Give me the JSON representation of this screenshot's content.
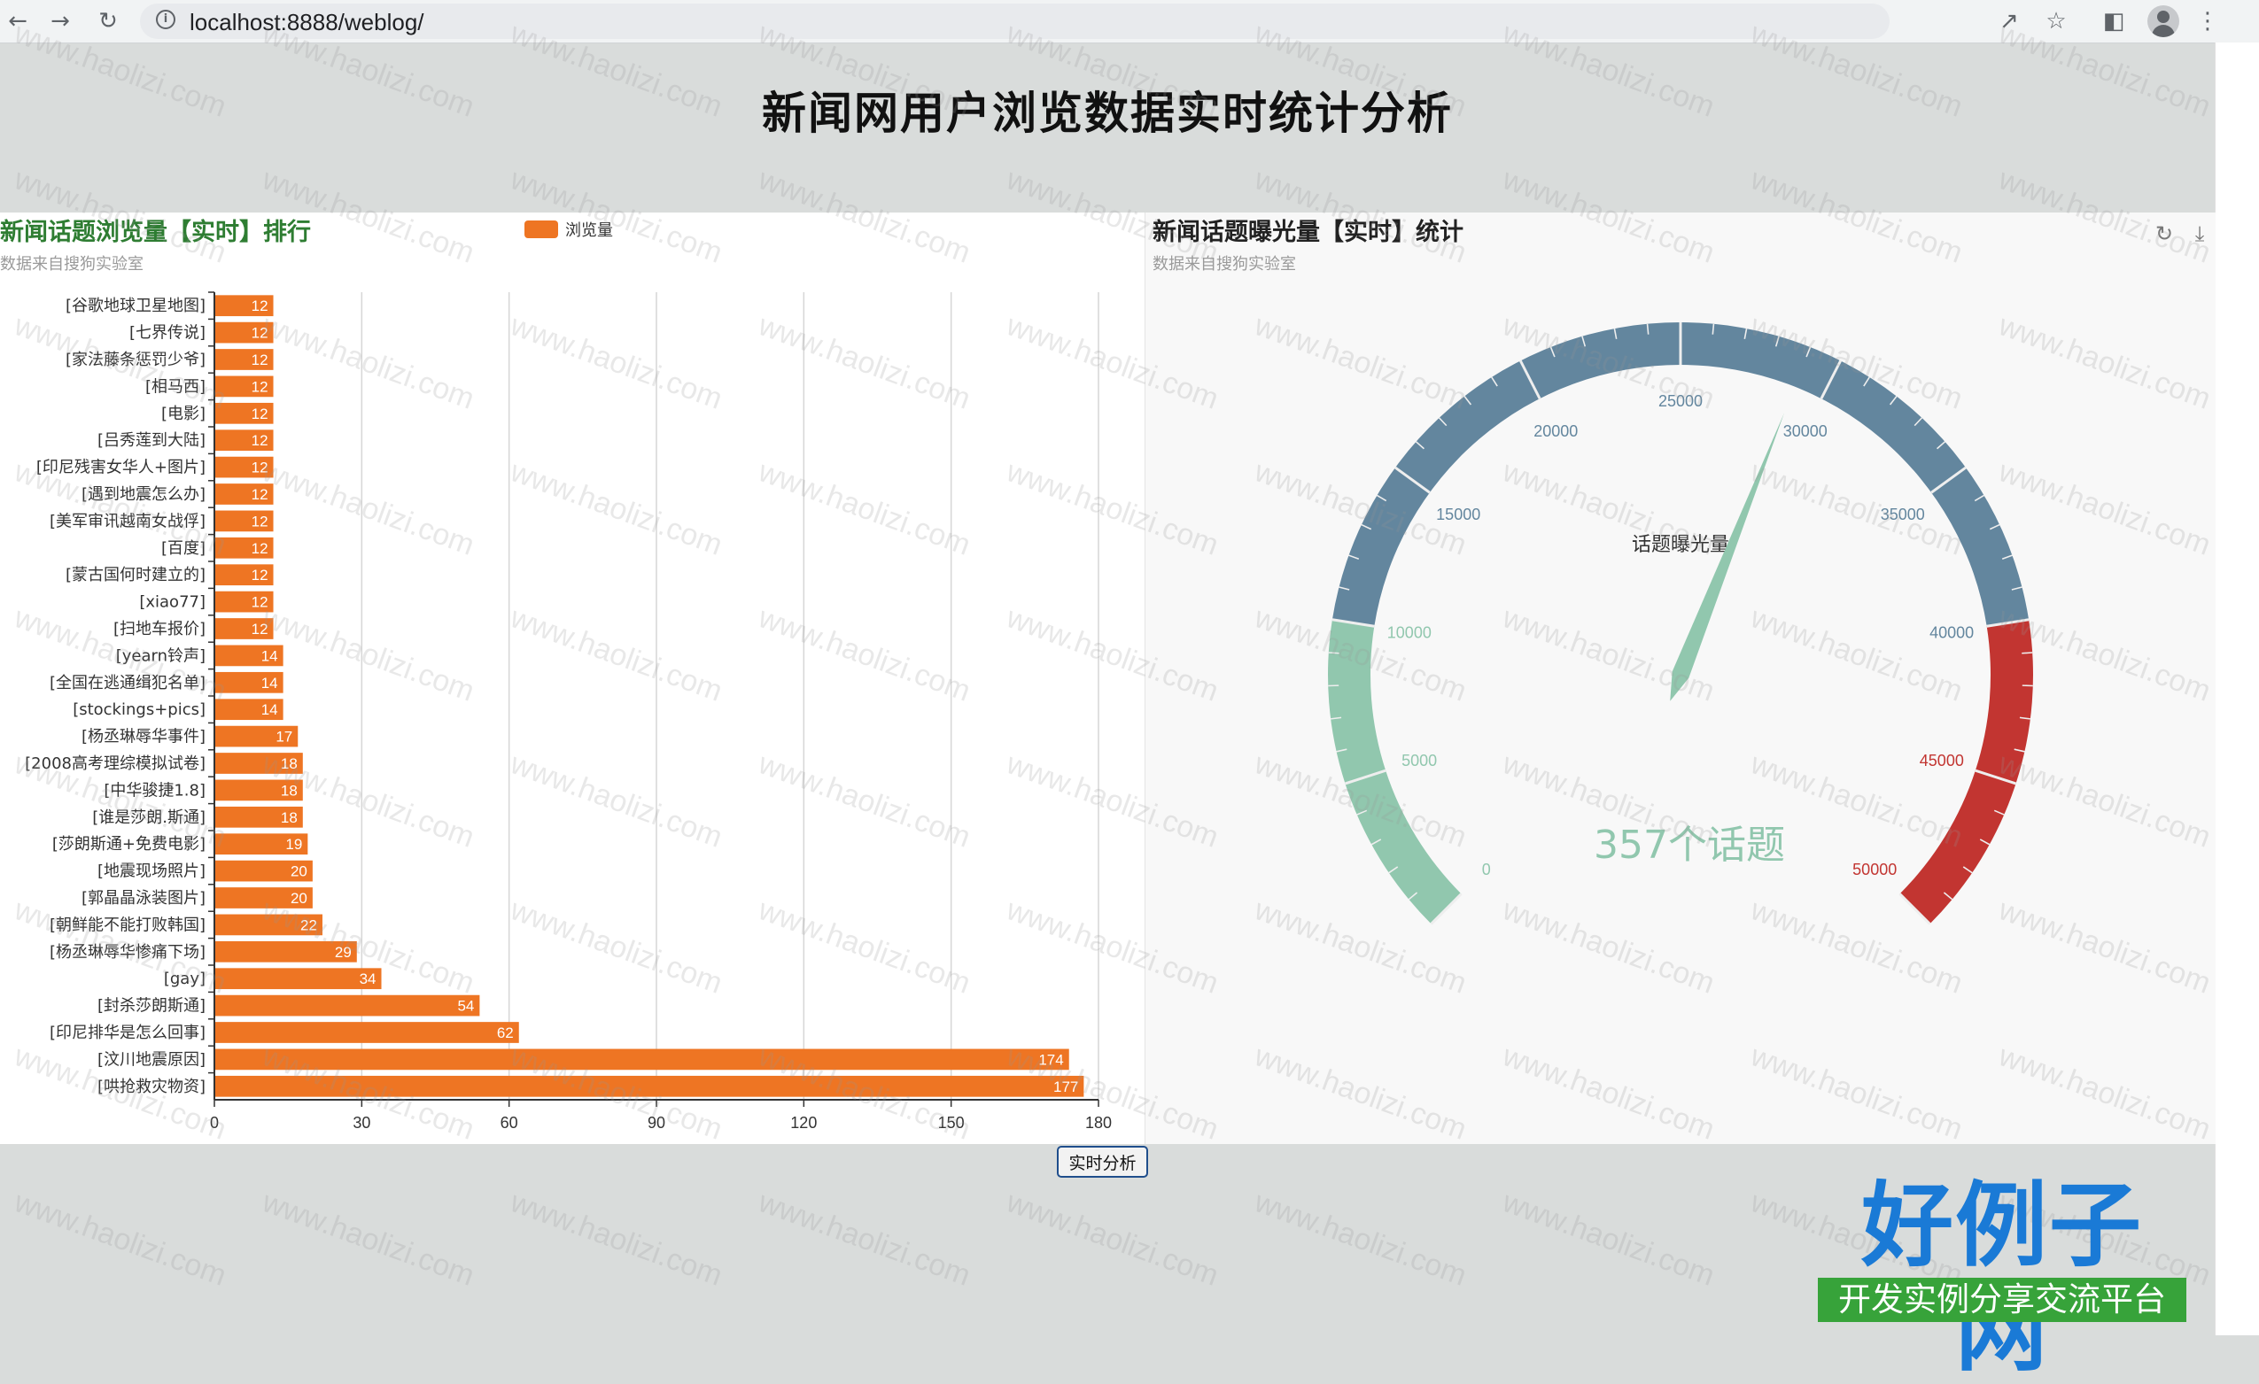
{
  "browser": {
    "url": "localhost:8888/weblog/",
    "info_glyph": "i"
  },
  "page": {
    "title": "新闻网用户浏览数据实时统计分析",
    "analyze_button": "实时分析"
  },
  "left_chart": {
    "title": "新闻话题浏览量【实时】排行",
    "subtitle": "数据来自搜狗实验室",
    "legend": "浏览量"
  },
  "right_chart": {
    "title": "新闻话题曝光量【实时】统计",
    "subtitle": "数据来自搜狗实验室"
  },
  "watermark": {
    "text": "www.haolizi.com",
    "brand_name": "好例子网",
    "brand_slogan": "开发实例分享交流平台"
  },
  "colors": {
    "bar": "#ee7523",
    "gauge_low": "#91c7ae",
    "gauge_mid": "#63869e",
    "gauge_high": "#c23531",
    "title_green": "#2e7d32"
  },
  "chart_data": [
    {
      "type": "bar",
      "orientation": "horizontal",
      "title": "新闻话题浏览量【实时】排行",
      "subtitle": "数据来自搜狗实验室",
      "legend": [
        "浏览量"
      ],
      "legend_position": "top-center",
      "xlim": [
        0,
        180
      ],
      "xticks": [
        0,
        30,
        60,
        90,
        120,
        150,
        180
      ],
      "grid": "vertical",
      "categories": [
        "[谷歌地球卫星地图]",
        "[七界传说]",
        "[家法藤条惩罚少爷]",
        "[相马西]",
        "[电影]",
        "[吕秀莲到大陆]",
        "[印尼残害女华人+图片]",
        "[遇到地震怎么办]",
        "[美军审讯越南女战俘]",
        "[百度]",
        "[蒙古国何时建立的]",
        "[xiao77]",
        "[扫地车报价]",
        "[yearn铃声]",
        "[全国在逃通缉犯名单]",
        "[stockings+pics]",
        "[杨丞琳辱华事件]",
        "[2008高考理综模拟试卷]",
        "[中华骏捷1.8]",
        "[谁是莎朗.斯通]",
        "[莎朗斯通+免费电影]",
        "[地震现场照片]",
        "[郭晶晶泳装图片]",
        "[朝鲜能不能打败韩国]",
        "[杨丞琳辱华惨痛下场]",
        "[gay]",
        "[封杀莎朗斯通]",
        "[印尼排华是怎么回事]",
        "[汶川地震原因]",
        "[哄抢救灾物资]"
      ],
      "series": [
        {
          "name": "浏览量",
          "values": [
            12,
            12,
            12,
            12,
            12,
            12,
            12,
            12,
            12,
            12,
            12,
            12,
            12,
            14,
            14,
            14,
            17,
            18,
            18,
            18,
            19,
            20,
            20,
            22,
            29,
            34,
            54,
            62,
            174,
            177
          ]
        }
      ]
    },
    {
      "type": "gauge",
      "title": "新闻话题曝光量【实时】统计",
      "subtitle": "数据来自搜狗实验室",
      "name": "话题曝光量",
      "min": 0,
      "max": 50000,
      "value": 29000,
      "detail": "357个话题",
      "tick_labels": [
        "0",
        "5000",
        "10000",
        "15000",
        "20000",
        "25000",
        "30000",
        "35000",
        "40000",
        "45000",
        "50000"
      ],
      "bands": [
        {
          "to_fraction": 0.2,
          "color": "#91c7ae"
        },
        {
          "to_fraction": 0.8,
          "color": "#63869e"
        },
        {
          "to_fraction": 1.0,
          "color": "#c23531"
        }
      ]
    }
  ]
}
